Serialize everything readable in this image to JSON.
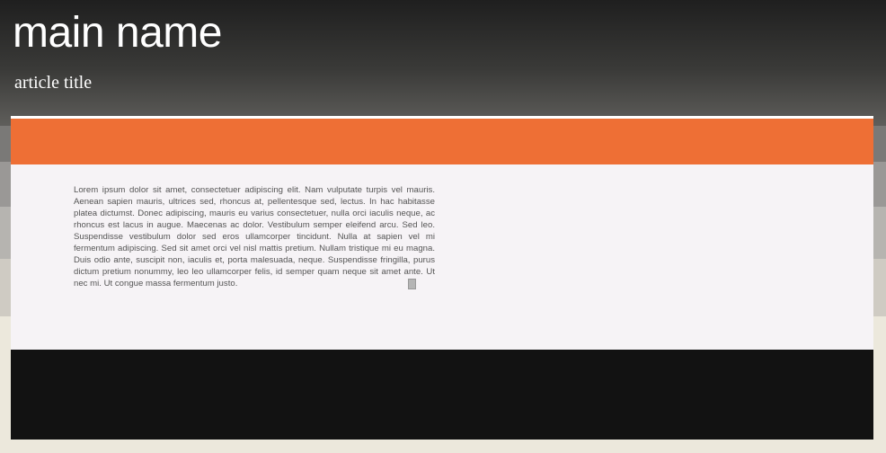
{
  "header": {
    "main_name": "main name",
    "article_title": "article title"
  },
  "content": {
    "body_text": "Lorem ipsum dolor sit amet, consectetuer adipiscing elit. Nam vulputate turpis vel mauris. Aenean sapien mauris, ultrices sed, rhoncus at, pellentesque sed, lectus. In hac habitasse platea dictumst. Donec adipiscing, mauris eu varius consectetuer, nulla orci iaculis neque, ac rhoncus est lacus in augue. Maecenas ac dolor. Vestibulum semper eleifend arcu. Sed leo. Suspendisse vestibulum dolor sed eros ullamcorper tincidunt. Nulla at sapien vel mi fermentum adipiscing. Sed sit amet orci vel nisl mattis pretium. Nullam tristique mi eu magna. Duis odio ante, suscipit non, iaculis et, porta malesuada, neque. Suspendisse fringilla, purus dictum pretium nonummy, leo leo ullamcorper felis, id semper quam neque sit amet ante. Ut nec mi. Ut congue massa fermentum justo."
  },
  "colors": {
    "accent_bar": "#ee6f35",
    "content_background": "#f6f3f6",
    "footer_bar": "#121212",
    "header_text": "#ffffff"
  }
}
